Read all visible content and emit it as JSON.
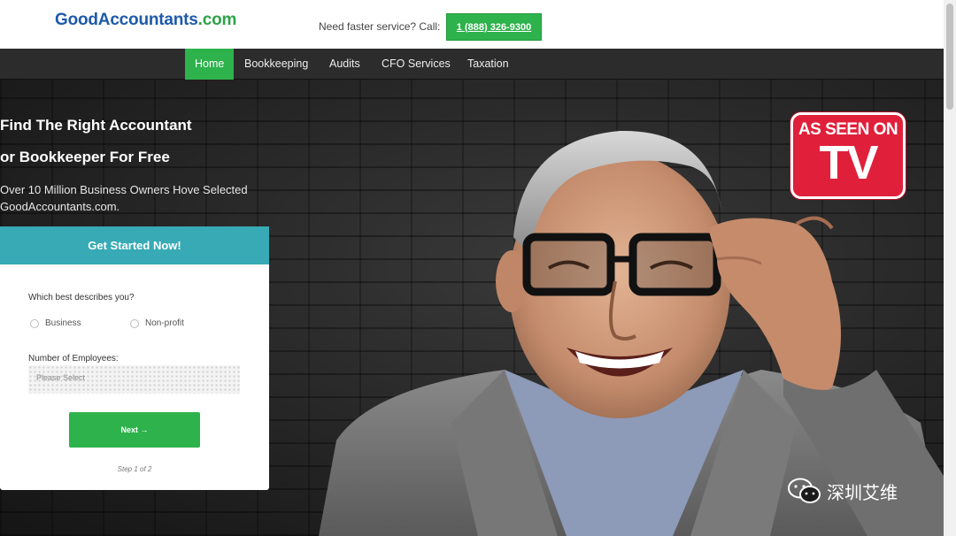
{
  "header": {
    "logo_main": "GoodAccountants",
    "logo_tld": ".com",
    "service_text": "Need faster service? Call:",
    "phone": "1 (888) 326-9300"
  },
  "nav": {
    "items": [
      "Home",
      "Bookkeeping",
      "Audits",
      "CFO Services",
      "Taxation"
    ],
    "active": "Home"
  },
  "hero": {
    "headline_1": "Find The Right Accountant",
    "headline_2": "or Bookkeeper For Free",
    "subline": "Over 10 Million Business Owners Hove Selected GoodAccountants.com.",
    "badge_top": "AS SEEN ON",
    "badge_big": "TV"
  },
  "form": {
    "title": "Get Started Now!",
    "question": "Which best describes you?",
    "option_1": "Business",
    "option_2": "Non-profit",
    "employees_label": "Number of Employees:",
    "employees_placeholder": "Please Select",
    "next_label": "Next →",
    "step_text": "Step 1 of 2"
  },
  "watermark": {
    "text": "深圳艾维",
    "icon": "wechat-icon"
  },
  "colors": {
    "brand_blue": "#1e5aa8",
    "brand_green": "#2eb24c",
    "form_head": "#37aab5",
    "tv_red": "#e0203a"
  }
}
